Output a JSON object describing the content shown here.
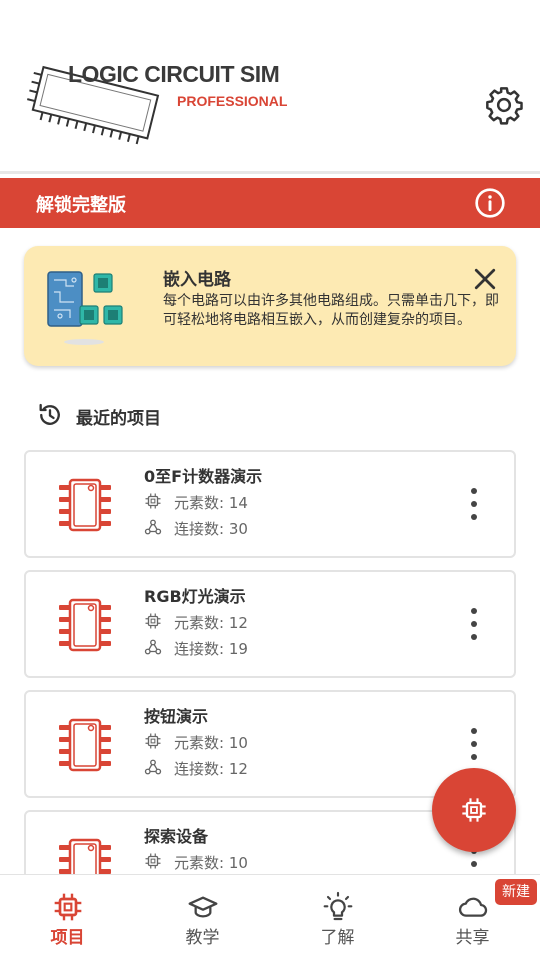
{
  "header": {
    "logo_title": "LOGIC CIRCUIT SIM",
    "logo_subtitle": "PROFESSIONAL",
    "settings_icon": "gear-icon"
  },
  "unlock_bar": {
    "label": "解锁完整版",
    "icon": "info-icon"
  },
  "tip": {
    "title": "嵌入电路",
    "body": "每个电路可以由许多其他电路组成。只需单击几下，即可轻松地将电路相互嵌入，从而创建复杂的项目。",
    "close_icon": "close-icon"
  },
  "recent": {
    "label": "最近的项目",
    "icon": "history-icon"
  },
  "projects": [
    {
      "name": "0至F计数器演示",
      "elements_label": "元素数: 14",
      "connections_label": "连接数: 30"
    },
    {
      "name": "RGB灯光演示",
      "elements_label": "元素数: 12",
      "connections_label": "连接数: 19"
    },
    {
      "name": "按钮演示",
      "elements_label": "元素数: 10",
      "connections_label": "连接数: 12"
    },
    {
      "name": "探索设备",
      "elements_label": "元素数: 10",
      "connections_label": ""
    }
  ],
  "fab": {
    "icon": "chip-icon"
  },
  "nav": {
    "items": [
      {
        "label": "项目",
        "icon": "chip-icon",
        "active": true
      },
      {
        "label": "教学",
        "icon": "graduation-cap-icon",
        "active": false
      },
      {
        "label": "了解",
        "icon": "lightbulb-icon",
        "active": false
      },
      {
        "label": "共享",
        "icon": "cloud-icon",
        "active": false
      }
    ],
    "badge": "新建"
  },
  "colors": {
    "accent": "#d94535",
    "tip_background": "#fdeab3",
    "text": "#333333",
    "muted": "#666666"
  }
}
